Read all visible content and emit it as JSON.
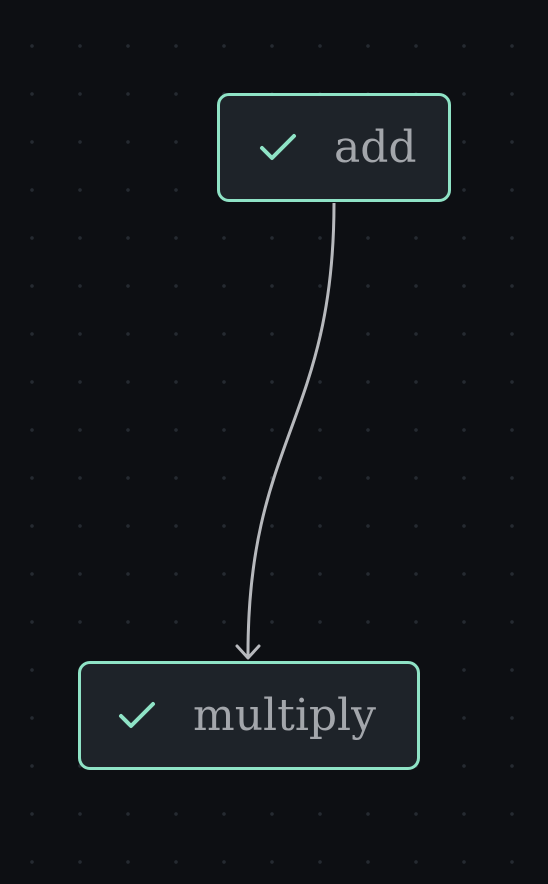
{
  "nodes": {
    "add": {
      "label": "add",
      "status_icon": "check-icon"
    },
    "multiply": {
      "label": "multiply",
      "status_icon": "check-icon"
    }
  },
  "edges": [
    {
      "from": "add",
      "to": "multiply"
    }
  ],
  "colors": {
    "background": "#0d0f13",
    "grid_dot": "#252a31",
    "node_fill": "#1e2329",
    "node_border": "#8fe3c6",
    "check": "#8fe3c6",
    "label_text": "#a3a6ab",
    "edge": "#b7b9bd"
  }
}
